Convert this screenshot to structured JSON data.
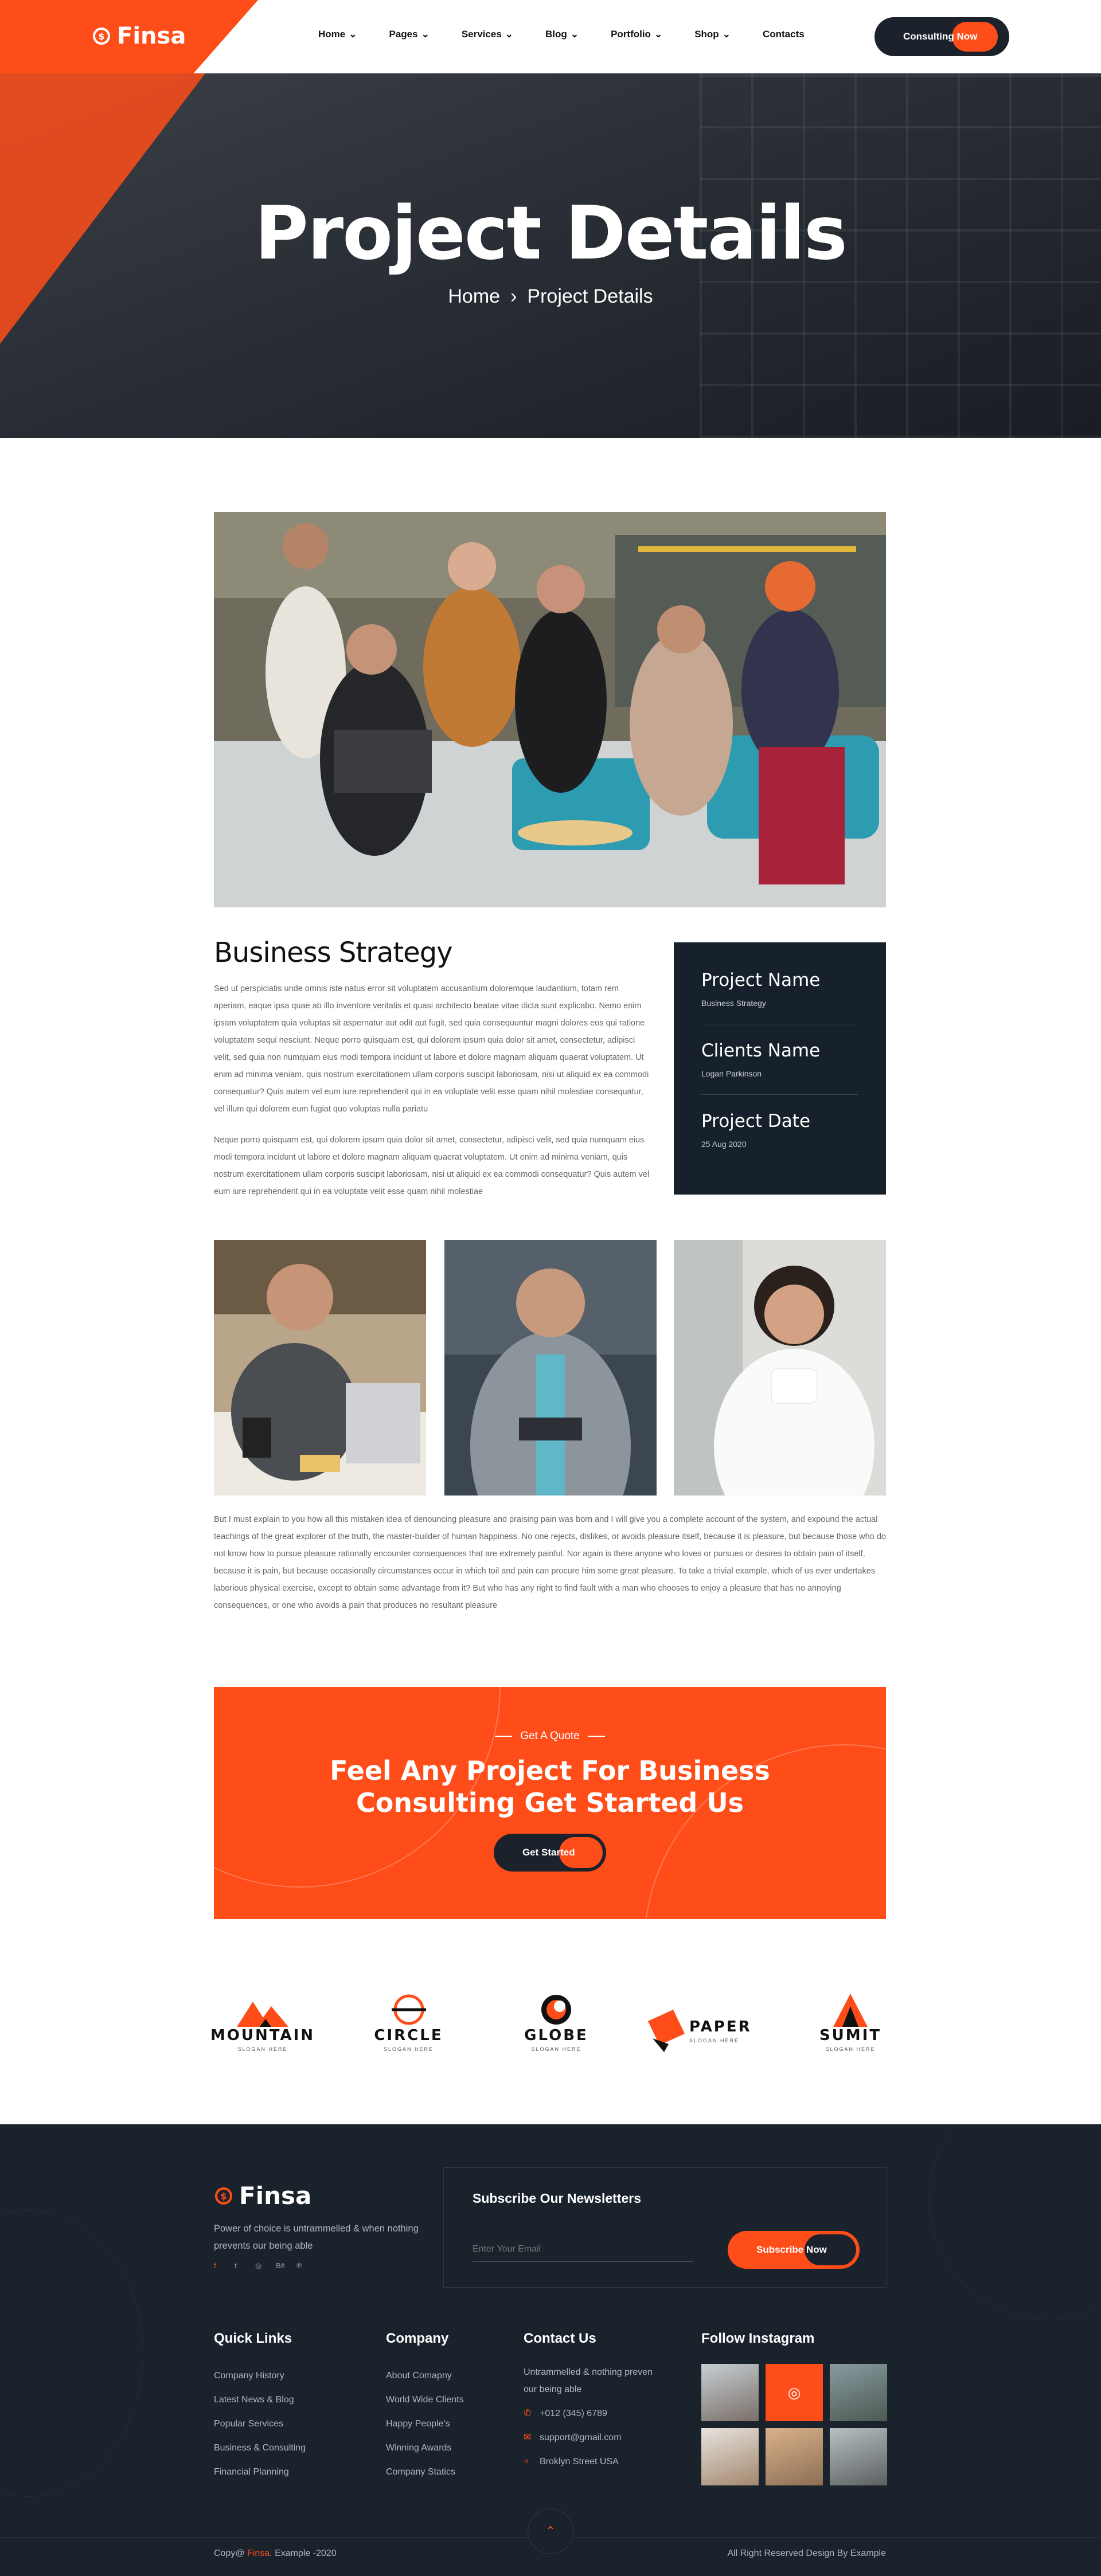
{
  "header": {
    "logo": "Finsa",
    "nav": [
      {
        "label": "Home",
        "has_dropdown": true
      },
      {
        "label": "Pages",
        "has_dropdown": true
      },
      {
        "label": "Services",
        "has_dropdown": true
      },
      {
        "label": "Blog",
        "has_dropdown": true
      },
      {
        "label": "Portfolio",
        "has_dropdown": true
      },
      {
        "label": "Shop",
        "has_dropdown": true
      },
      {
        "label": "Contacts",
        "has_dropdown": false
      }
    ],
    "cta_label": "Consulting Now"
  },
  "hero": {
    "title": "Project Details",
    "breadcrumb_home": "Home",
    "breadcrumb_current": "Project Details"
  },
  "project": {
    "heading": "Business Strategy",
    "para1": "Sed ut perspiciatis unde omnis iste natus error sit voluptatem accusantium doloremque laudantium, totam rem aperiam, eaque ipsa quae ab illo inventore veritatis et quasi architecto beatae vitae dicta sunt explicabo. Nemo enim ipsam voluptatem quia voluptas sit aspernatur aut odit aut fugit, sed quia consequuntur magni dolores eos qui ratione voluptatem sequi nesciunt. Neque porro quisquam est, qui dolorem ipsum quia dolor sit amet, consectetur, adipisci velit, sed quia non numquam eius modi tempora incidunt ut labore et dolore magnam aliquam quaerat voluptatem. Ut enim ad minima veniam, quis nostrum exercitationem ullam corporis suscipit laboriosam, nisi ut aliquid ex ea commodi consequatur? Quis autem vel eum iure reprehenderit qui in ea voluptate velit esse quam nihil molestiae consequatur, vel illum qui dolorem eum fugiat quo voluptas nulla pariatu",
    "para2": "Neque porro quisquam est, qui dolorem ipsum quia dolor sit amet, consectetur, adipisci velit, sed quia numquam eius modi tempora incidunt ut labore et dolore magnam aliquam quaerat voluptatem. Ut enim ad minima veniam, quis nostrum exercitationem ullam corporis suscipit laboriosam, nisi ut aliquid ex ea commodi consequatur? Quis autem vel eum iure reprehenderit qui in ea voluptate velit esse quam nihil molestiae",
    "para3": "But I must explain to you how all this mistaken idea of denouncing pleasure and praising pain was born and I will give you a complete account of the system, and expound the actual teachings of the great explorer of the truth, the master-builder of human happiness. No one rejects, dislikes, or avoids pleasure itself, because it is pleasure, but because those who do not know how to pursue pleasure rationally encounter consequences that are extremely painful. Nor again is there anyone who loves or pursues or desires to obtain pain of itself, because it is pain, but because occasionally circumstances occur in which toil and pain can procure him some great pleasure. To take a trivial example, which of us ever undertakes laborious physical exercise, except to obtain some advantage from it? But who has any right to find fault with a man who chooses to enjoy a pleasure that has no annoying consequences, or one who avoids a pain that produces no resultant pleasure",
    "info": [
      {
        "label": "Project Name",
        "value": "Business Strategy"
      },
      {
        "label": "Clients Name",
        "value": "Logan Parkinson"
      },
      {
        "label": "Project Date",
        "value": "25 Aug 2020"
      }
    ]
  },
  "quote": {
    "tag": "Get A Quote",
    "line1": "Feel Any Project For Business",
    "line2": "Consulting Get Started Us",
    "button": "Get Started"
  },
  "brands": [
    {
      "name": "MOUNTAIN",
      "slogan": "SLOGAN HERE"
    },
    {
      "name": "CIRCLE",
      "slogan": "SLOGAN HERE"
    },
    {
      "name": "GLOBE",
      "slogan": "SLOGAN HERE"
    },
    {
      "name": "PAPER",
      "slogan": "SLOGAN HERE"
    },
    {
      "name": "SUMIT",
      "slogan": "SLOGAN HERE"
    }
  ],
  "footer": {
    "logo": "Finsa",
    "about": "Power of choice is untrammelled & when nothing prevents our being able",
    "newsletter_title": "Subscribe Our Newsletters",
    "email_placeholder": "Enter Your Email",
    "subscribe_label": "Subscribe Now",
    "quick_links_title": "Quick Links",
    "quick_links": [
      "Company History",
      "Latest News & Blog",
      "Popular Services",
      "Business & Consulting",
      "Financial Planning"
    ],
    "company_title": "Company",
    "company_links": [
      "About Comapny",
      "World Wide Clients",
      "Happy People's",
      "Winning Awards",
      "Company Statics"
    ],
    "contact_title": "Contact Us",
    "contact_text": "Untrammelled & nothing preven our being able",
    "phone": "+012 (345) 6789",
    "email": "support@gmail.com",
    "address": "Broklyn Street USA",
    "instagram_title": "Follow Instagram",
    "copy_prefix": "Copy@",
    "copy_brand": "Finsa",
    "copy_suffix": ". Example -2020",
    "rights": "All Right Reserved Design By Example"
  },
  "colors": {
    "accent": "#ff4d1a",
    "dark": "#1a222c"
  }
}
